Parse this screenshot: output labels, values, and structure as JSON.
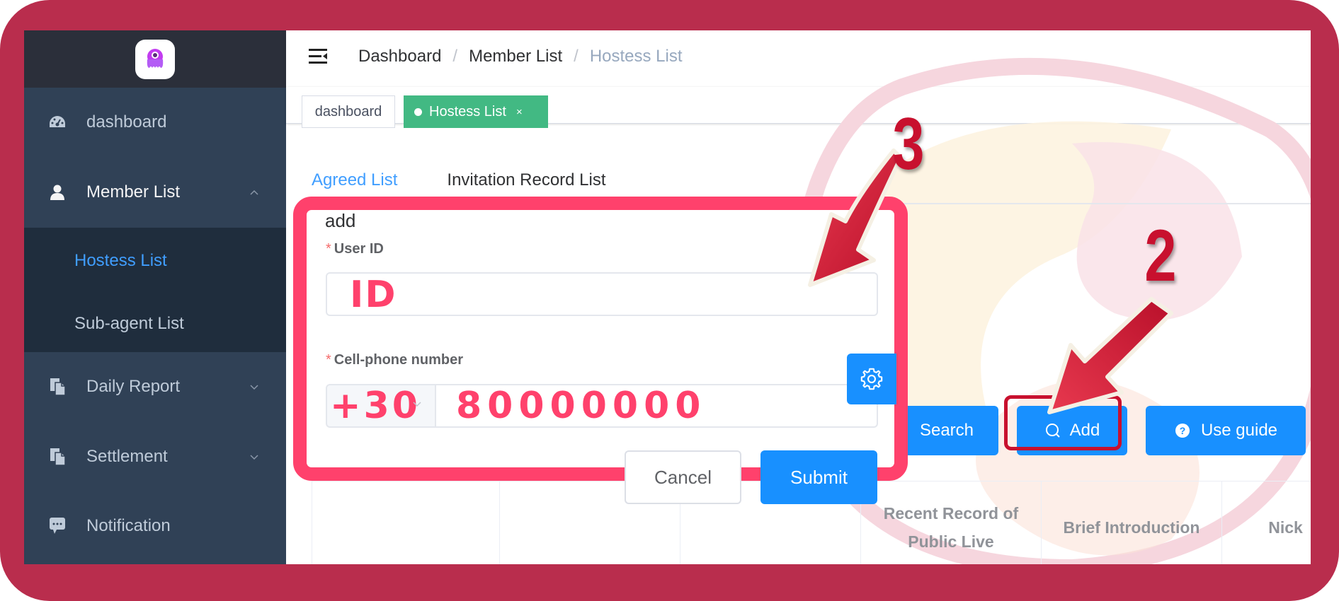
{
  "sidebar": {
    "items": [
      {
        "label": "dashboard",
        "icon": "dashboard-gauge-icon"
      },
      {
        "label": "Member List",
        "icon": "user-icon",
        "expanded": true,
        "children": [
          {
            "label": "Hostess List",
            "active": true
          },
          {
            "label": "Sub-agent List"
          }
        ]
      },
      {
        "label": "Daily Report",
        "icon": "documents-icon"
      },
      {
        "label": "Settlement",
        "icon": "documents-icon"
      },
      {
        "label": "Notification",
        "icon": "chat-bubble-icon"
      }
    ]
  },
  "navbar": {
    "breadcrumb": [
      "Dashboard",
      "Member List",
      "Hostess List"
    ]
  },
  "tags_view": {
    "tags": [
      {
        "label": "dashboard",
        "active": false
      },
      {
        "label": "Hostess List",
        "active": true,
        "close": "×"
      }
    ]
  },
  "tabs": [
    {
      "label": "Agreed List",
      "active": true
    },
    {
      "label": "Invitation Record List",
      "active": false
    }
  ],
  "toolbar": {
    "search_label": "Search",
    "add_label": "Add",
    "guide_label": "Use guide"
  },
  "table": {
    "headers": [
      "",
      "",
      "",
      "Recent Record of Public Live",
      "Brief Introduction",
      "Nick"
    ]
  },
  "dialog": {
    "title": "add",
    "user_id_label": "User ID",
    "user_id_value": "ID",
    "phone_label": "Cell-phone number",
    "phone_prefix": "+30",
    "phone_value": "80000000",
    "required_mark": "*",
    "cancel_label": "Cancel",
    "submit_label": "Submit"
  },
  "annotations": {
    "step_add": "2",
    "step_dialog": "3"
  },
  "colors": {
    "frame": "#b92d4d",
    "sidebar_bg": "#304156",
    "primary": "#1890ff",
    "tag_active": "#42b983",
    "highlight": "#ff416c",
    "annotation_red": "#c8102e"
  }
}
